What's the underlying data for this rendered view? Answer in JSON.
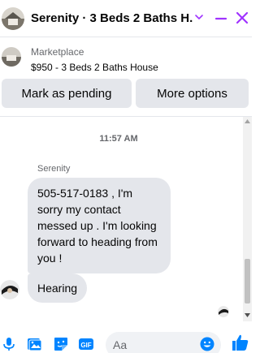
{
  "header": {
    "title": "Serenity · 3 Beds 2 Baths H...",
    "icons": {
      "chevron": "chevron-down-icon",
      "minimize": "minimize-icon",
      "close": "close-icon"
    },
    "accent_color": "#a033ff"
  },
  "marketplace": {
    "label": "Marketplace",
    "listing": "$950 - 3 Beds 2 Baths House"
  },
  "actions": {
    "pending_label": "Mark as pending",
    "more_label": "More options"
  },
  "conversation": {
    "timestamp": "11:57 AM",
    "sender_name": "Serenity",
    "messages": [
      {
        "text": "505-517-0183 , I'm sorry my contact messed up . I'm looking forward to heading from you !"
      },
      {
        "text": "Hearing"
      }
    ]
  },
  "composer": {
    "placeholder": "Aa",
    "icons": [
      "microphone-icon",
      "image-icon",
      "sticker-icon",
      "gif-icon",
      "emoji-icon",
      "like-icon"
    ],
    "brand_color": "#0084ff"
  }
}
